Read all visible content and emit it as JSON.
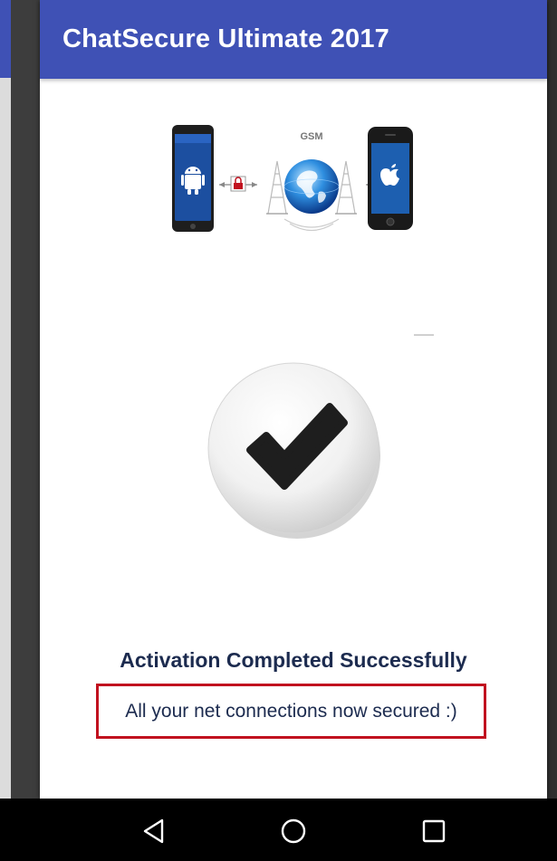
{
  "app": {
    "title": "ChatSecure Ultimate 2017"
  },
  "hero": {
    "network_label": "GSM",
    "left_device": "android-phone",
    "right_device": "apple-phone"
  },
  "status": {
    "headline": "Activation Completed Successfully",
    "message": "All your net connections now secured :)"
  },
  "navigation": {
    "back": "back-icon",
    "home": "home-icon",
    "recents": "recents-icon"
  },
  "colors": {
    "appbar": "#3f51b5",
    "headline": "#1c2b4f",
    "message_border": "#c1121f"
  }
}
